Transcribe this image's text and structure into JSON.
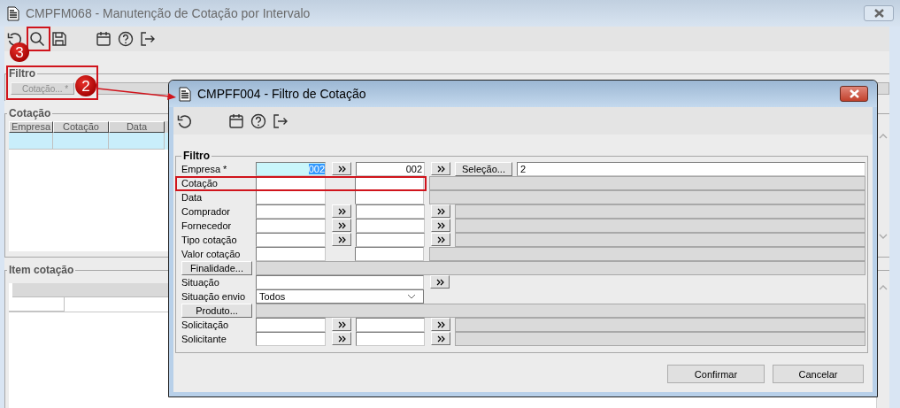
{
  "window": {
    "title": "CMPFM068 - Manutenção de Cotação por Intervalo",
    "active": false
  },
  "filter_group": {
    "legend": "Filtro",
    "button": "Cotação... *",
    "disabled": true
  },
  "cotacao_group": {
    "legend": "Cotação",
    "columns": [
      "Empresa",
      "Cotação",
      "Data"
    ],
    "rows": [
      {
        "selected": true
      }
    ]
  },
  "item_group": {
    "legend": "Item cotação"
  },
  "dialog": {
    "title": "CMPFF004 - Filtro de Cotação",
    "group_legend": "Filtro",
    "rows": [
      {
        "kind": "range_select",
        "label": "Empresa *",
        "from": "002",
        "to": "002",
        "focused": true,
        "button": "Seleção...",
        "value": "2"
      },
      {
        "kind": "range_desc",
        "label": "Cotação"
      },
      {
        "kind": "range_desc",
        "label": "Data"
      },
      {
        "kind": "range_lookup",
        "label": "Comprador"
      },
      {
        "kind": "range_lookup",
        "label": "Fornecedor"
      },
      {
        "kind": "range_lookup",
        "label": "Tipo cotação"
      },
      {
        "kind": "range_desc",
        "label": "Valor cotação"
      },
      {
        "kind": "button_desc",
        "button": "Finalidade..."
      },
      {
        "kind": "single_lookup",
        "label": "Situação"
      },
      {
        "kind": "dropdown",
        "label": "Situação envio",
        "value": "Todos"
      },
      {
        "kind": "button_desc",
        "button": "Produto..."
      },
      {
        "kind": "range_lookup",
        "label": "Solicitação"
      },
      {
        "kind": "range_lookup",
        "label": "Solicitante"
      }
    ],
    "buttons": [
      "Confirmar",
      "Cancelar"
    ]
  },
  "annotations": [
    {
      "number": "3"
    },
    {
      "number": "2"
    }
  ]
}
